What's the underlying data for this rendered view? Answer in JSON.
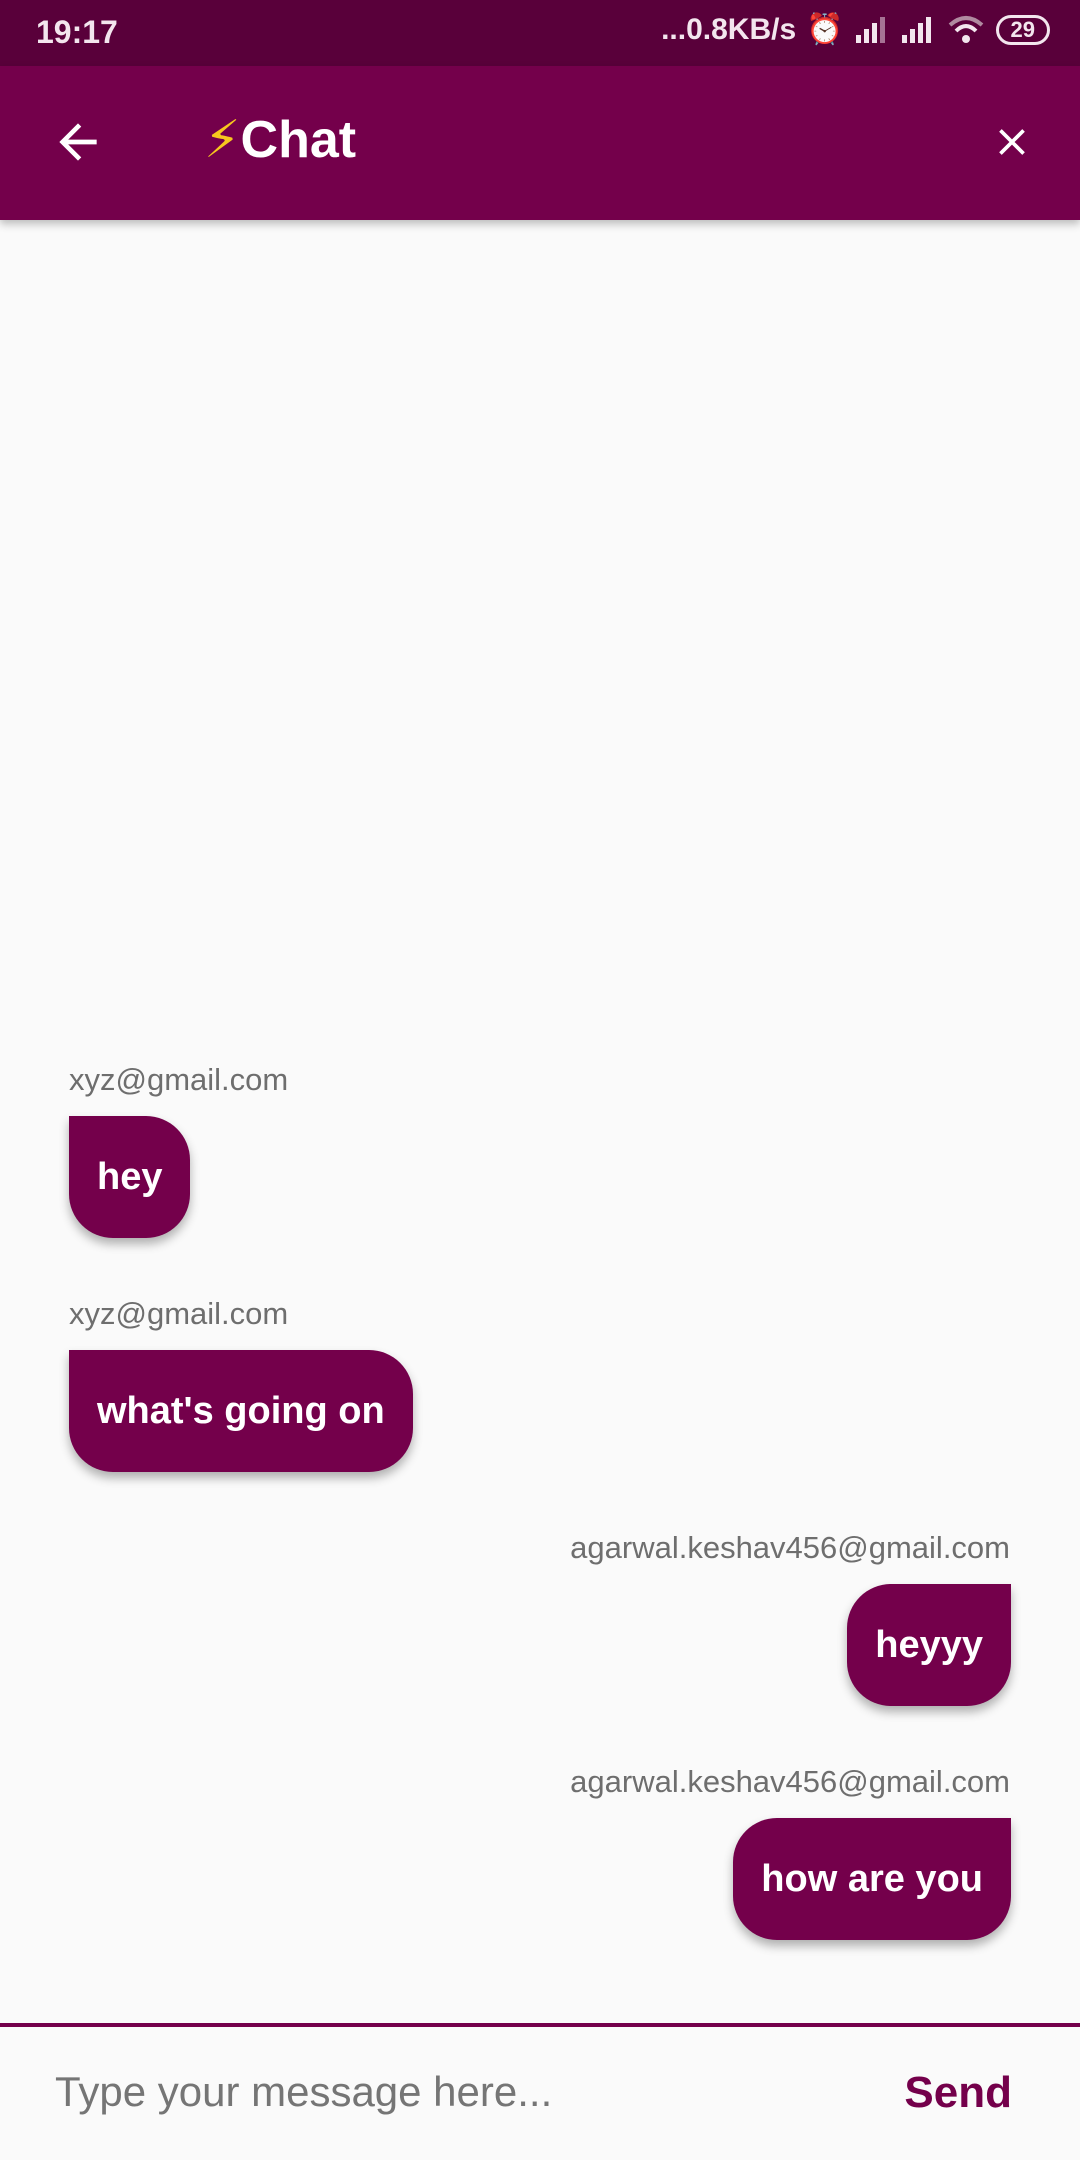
{
  "status_bar": {
    "time": "19:17",
    "network_speed": "...0.8KB/s",
    "battery": "29"
  },
  "app_bar": {
    "title_icon": "⚡",
    "title": "Chat"
  },
  "messages": [
    {
      "sender": "xyz@gmail.com",
      "text": "hey",
      "direction": "received"
    },
    {
      "sender": "xyz@gmail.com",
      "text": "what's going on",
      "direction": "received"
    },
    {
      "sender": "agarwal.keshav456@gmail.com",
      "text": "heyyy",
      "direction": "sent"
    },
    {
      "sender": "agarwal.keshav456@gmail.com",
      "text": "how are you",
      "direction": "sent"
    }
  ],
  "composer": {
    "placeholder": "Type your message here...",
    "value": "",
    "send_label": "Send"
  },
  "colors": {
    "primary": "#74004b",
    "status_bar": "#59003a",
    "background": "#fafafa"
  }
}
